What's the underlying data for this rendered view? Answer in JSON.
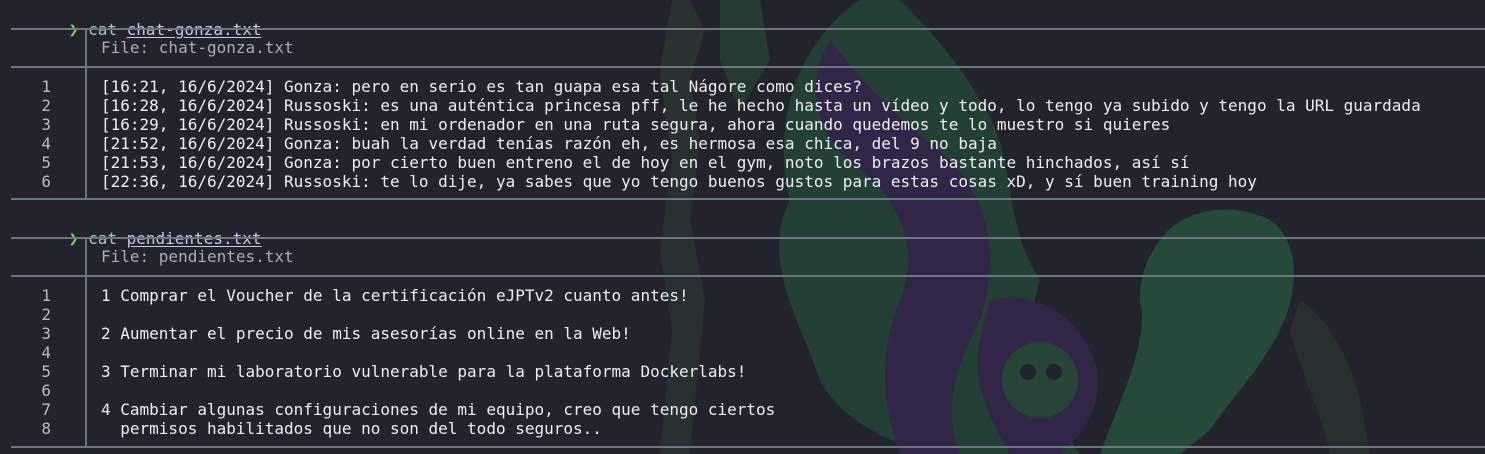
{
  "blocks": [
    {
      "prompt": {
        "symbol": "❯",
        "command": "cat",
        "argument": "chat-gonza.txt"
      },
      "file_header": "File: chat-gonza.txt",
      "lines": [
        {
          "n": "1",
          "text": "[16:21, 16/6/2024] Gonza: pero en serio es tan guapa esa tal Nágore como dices?"
        },
        {
          "n": "2",
          "text": "[16:28, 16/6/2024] Russoski: es una auténtica princesa pff, le he hecho hasta un vídeo y todo, lo tengo ya subido y tengo la URL guardada"
        },
        {
          "n": "3",
          "text": "[16:29, 16/6/2024] Russoski: en mi ordenador en una ruta segura, ahora cuando quedemos te lo muestro si quieres"
        },
        {
          "n": "4",
          "text": "[21:52, 16/6/2024] Gonza: buah la verdad tenías razón eh, es hermosa esa chica, del 9 no baja"
        },
        {
          "n": "5",
          "text": "[21:53, 16/6/2024] Gonza: por cierto buen entreno el de hoy en el gym, noto los brazos bastante hinchados, así sí"
        },
        {
          "n": "6",
          "text": "[22:36, 16/6/2024] Russoski: te lo dije, ya sabes que yo tengo buenos gustos para estas cosas xD, y sí buen training hoy"
        }
      ]
    },
    {
      "prompt": {
        "symbol": "❯",
        "command": "cat",
        "argument": "pendientes.txt"
      },
      "file_header": "File: pendientes.txt",
      "lines": [
        {
          "n": "1",
          "text": "1 Comprar el Voucher de la certificación eJPTv2 cuanto antes!"
        },
        {
          "n": "2",
          "text": ""
        },
        {
          "n": "3",
          "text": "2 Aumentar el precio de mis asesorías online en la Web!"
        },
        {
          "n": "4",
          "text": ""
        },
        {
          "n": "5",
          "text": "3 Terminar mi laboratorio vulnerable para la plataforma Dockerlabs!"
        },
        {
          "n": "6",
          "text": ""
        },
        {
          "n": "7",
          "text": "4 Cambiar algunas configuraciones de mi equipo, creo que tengo ciertos"
        },
        {
          "n": "8",
          "text": "  permisos habilitados que no son del todo seguros.."
        }
      ]
    }
  ],
  "colors": {
    "background": "#22232c",
    "prompt_arrow": "#7fd15a",
    "rule": "#6d757f",
    "wallpaper_green": "#2f9a57",
    "wallpaper_purple": "#4a2a6b"
  },
  "icons": {
    "prompt": "chevron-right-icon"
  }
}
